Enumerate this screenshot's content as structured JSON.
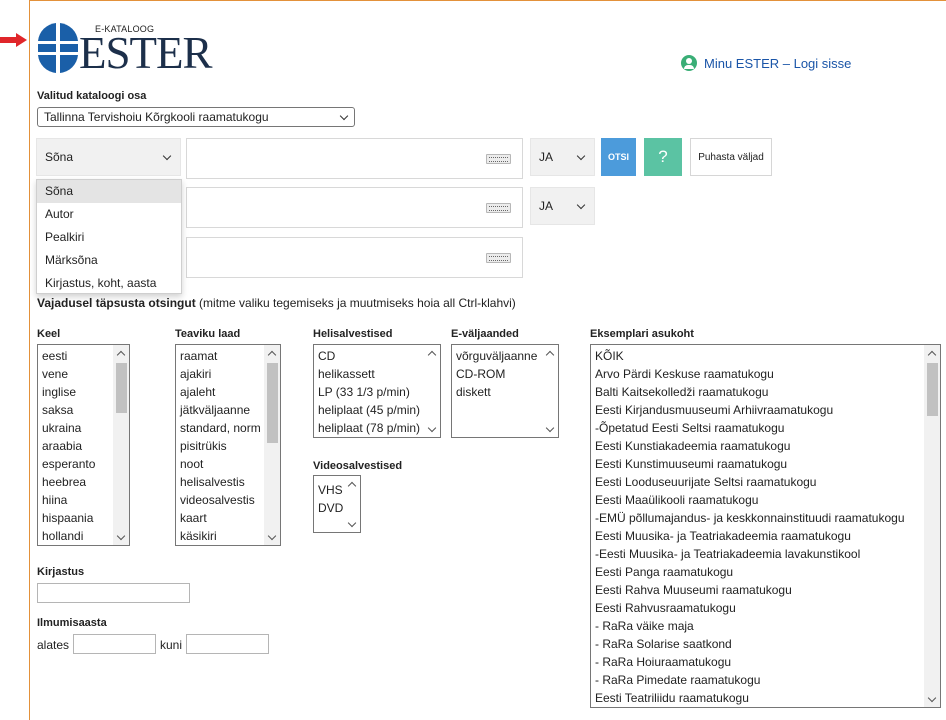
{
  "brand": {
    "tag": "E-KATALOOG",
    "name": "ESTER",
    "blue": "#1c2f4a"
  },
  "login": {
    "icon": "user-icon",
    "label": "Minu ESTER – Logi sisse"
  },
  "catalog": {
    "label": "Valitud kataloogi osa",
    "selected": "Tallinna Tervishoiu Kõrgkooli raamatukogu"
  },
  "search": {
    "rows": [
      {
        "field": "Sõna",
        "operator": "JA"
      },
      {
        "field": "",
        "operator": "JA"
      },
      {
        "field": ""
      }
    ],
    "field_options": [
      "Sõna",
      "Autor",
      "Pealkiri",
      "Märksõna",
      "Kirjastus, koht, aasta"
    ],
    "keyboard_icon": "keyboard-icon",
    "search_label": "OTSI",
    "help_label": "?",
    "clear_label": "Puhasta väljad",
    "otsi_color": "#4c9bdb",
    "help_color": "#5bc3a3"
  },
  "hint": {
    "bold": "Vajadusel täpsusta otsingut",
    "rest": " (mitme valiku tegemiseks ja muutmiseks hoia all Ctrl-klahvi)"
  },
  "filters": {
    "language": {
      "label": "Keel",
      "options": [
        "eesti",
        "vene",
        "inglise",
        "saksa",
        "ukraina",
        "araabia",
        "esperanto",
        "heebrea",
        "hiina",
        "hispaania",
        "hollandi"
      ]
    },
    "material": {
      "label": "Teaviku laad",
      "options": [
        "raamat",
        "ajakiri",
        "ajaleht",
        "jätkväljaanne",
        "standard, norm",
        "pisitrükis",
        "noot",
        "helisalvestis",
        "videosalvestis",
        "kaart",
        "käsikiri"
      ]
    },
    "audio": {
      "label": "Helisalvestised",
      "options": [
        "CD",
        "helikassett",
        "LP (33 1/3 p/min)",
        "heliplaat (45 p/min)",
        "heliplaat (78 p/min)"
      ]
    },
    "eformat": {
      "label": "E-väljaanded",
      "options": [
        "võrguväljaanne",
        "CD-ROM",
        "diskett"
      ]
    },
    "video": {
      "label": "Videosalvestised",
      "options": [
        "VHS",
        "DVD"
      ]
    },
    "location": {
      "label": "Eksemplari asukoht",
      "options": [
        "KÕIK",
        "Arvo Pärdi Keskuse raamatukogu",
        "Balti Kaitsekolledži raamatukogu",
        "Eesti Kirjandusmuuseumi Arhiivraamatukogu",
        "-Õpetatud Eesti Seltsi raamatukogu",
        "Eesti Kunstiakadeemia raamatukogu",
        "Eesti Kunstimuuseumi raamatukogu",
        "Eesti Looduseuurijate Seltsi raamatukogu",
        "Eesti Maaülikooli raamatukogu",
        "-EMÜ põllumajandus- ja keskkonnainstituudi raamatukogu",
        "Eesti Muusika- ja Teatriakadeemia raamatukogu",
        "-Eesti Muusika- ja Teatriakadeemia lavakunstikool",
        "Eesti Panga raamatukogu",
        "Eesti Rahva Muuseumi raamatukogu",
        "Eesti Rahvusraamatukogu",
        "- RaRa väike maja",
        "- RaRa Solarise saatkond",
        "- RaRa Hoiuraamatukogu",
        "- RaRa Pimedate raamatukogu",
        "Eesti Teatriliidu raamatukogu"
      ]
    },
    "publisher": {
      "label": "Kirjastus",
      "value": ""
    },
    "year": {
      "label": "Ilmumisaasta",
      "from_label": "alates",
      "to_label": "kuni",
      "from": "",
      "to": ""
    }
  }
}
